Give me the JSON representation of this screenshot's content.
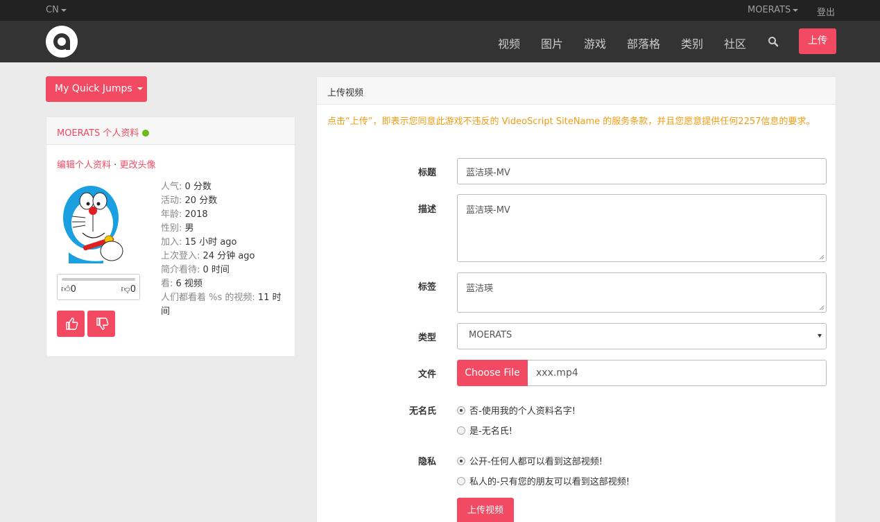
{
  "topbar": {
    "lang": "CN",
    "username": "MOERATS",
    "logout": "登出"
  },
  "nav": {
    "items": [
      "视频",
      "图片",
      "游戏",
      "部落格",
      "类别",
      "社区"
    ],
    "upload": "上传",
    "search_icon": "search-icon"
  },
  "quick_jumps": "My Quick Jumps",
  "profile": {
    "title": "MOERATS 个人资料",
    "online_color": "#6cba1b",
    "edit_profile": "编辑个人资料",
    "separator": "·",
    "change_avatar": "更改头像",
    "likes": "0",
    "dislikes": "0",
    "stats": [
      {
        "label": "人气:",
        "value": "0 分数"
      },
      {
        "label": "活动:",
        "value": "20 分数"
      },
      {
        "label": "年龄:",
        "value": "2018"
      },
      {
        "label": "性别:",
        "value": "男"
      },
      {
        "label": "加入:",
        "value": "15 小时 ago"
      },
      {
        "label": "上次登入:",
        "value": "24 分钟 ago"
      },
      {
        "label": "简介看待:",
        "value": "0 时间"
      },
      {
        "label": "看:",
        "value": "6 视频"
      },
      {
        "label": "人们都看着 %s 的视频:",
        "value": "11 时间"
      }
    ]
  },
  "upload": {
    "heading": "上传视频",
    "terms": "点击“上传”，即表示您同意此游戏不违反的 VideoScript SiteName 的服务条款，并且您愿意提供任何2257信息的要求。",
    "title_label": "标题",
    "title_value": "蓝洁瑛-MV",
    "desc_label": "描述",
    "desc_value": "蓝洁瑛-MV",
    "tags_label": "标签",
    "tags_value": "蓝洁瑛",
    "type_label": "类型",
    "type_value": "MOERATS",
    "file_label": "文件",
    "choose_file": "Choose File",
    "file_name": "xxx.mp4",
    "anon_label": "无名氏",
    "anon_options": [
      "否-使用我的个人资料名字!",
      "是-无名氏!"
    ],
    "anon_selected": 0,
    "privacy_label": "隐私",
    "privacy_options": [
      "公开-任何人都可以看到这部视频!",
      "私人的-只有您的朋友可以看到这部视频!"
    ],
    "privacy_selected": 0,
    "submit": "上传视频"
  },
  "colors": {
    "accent": "#f34a63",
    "topbar": "#222222",
    "navbar": "#333333",
    "terms": "#f39c12"
  }
}
